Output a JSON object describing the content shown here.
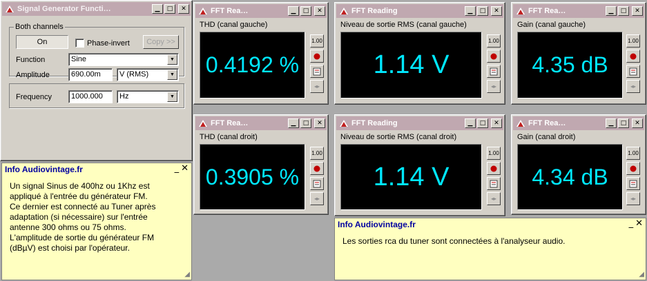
{
  "signal_generator": {
    "title": "Signal Generator Functi…",
    "group_label": "Both channels",
    "on_label": "On",
    "phase_invert_label": "Phase-invert",
    "copy_label": "Copy >>",
    "function_label": "Function",
    "function_value": "Sine",
    "amplitude_label": "Amplitude",
    "amplitude_value": "690.00m",
    "amplitude_unit": "V (RMS)",
    "frequency_label": "Frequency",
    "frequency_value": "1000.000",
    "frequency_unit": "Hz"
  },
  "fft_windows": [
    {
      "title": "FFT Rea…",
      "label": "THD (canal gauche)",
      "value": "0.4192 %"
    },
    {
      "title": "FFT Reading",
      "label": "Niveau de sortie RMS  (canal gauche)",
      "value": "1.14 V"
    },
    {
      "title": "FFT Rea…",
      "label": "Gain (canal gauche)",
      "value": "4.35 dB"
    },
    {
      "title": "FFT Rea…",
      "label": "THD (canal droit)",
      "value": "0.3905 %"
    },
    {
      "title": "FFT Reading",
      "label": "Niveau de sortie RMS (canal droit)",
      "value": "1.14 V"
    },
    {
      "title": "FFT Rea…",
      "label": "Gain (canal droit)",
      "value": "4.34 dB"
    }
  ],
  "tool_buttons": {
    "meter": "1.00",
    "arrows": "◂▸"
  },
  "info_left": {
    "title": "Info Audiovintage.fr",
    "body": "Un signal Sinus de 400hz ou 1Khz  est\nappliqué à l'entrée du générateur FM.\nCe dernier est connecté au Tuner après\nadaptation (si nécessaire) sur l'entrée\nantenne 300 ohms ou 75 ohms.\nL'amplitude de sortie du générateur FM\n(dBµV) est choisi par l'opérateur."
  },
  "info_right": {
    "title": "Info Audiovintage.fr",
    "body": "Les sorties rca du tuner sont connectées à l'analyseur audio."
  },
  "colors": {
    "readout": "#00e8ff",
    "display_bg": "#000000",
    "titlebar": "#c0a8b0",
    "info_bg": "#ffffc0",
    "info_title": "#0000a0"
  }
}
